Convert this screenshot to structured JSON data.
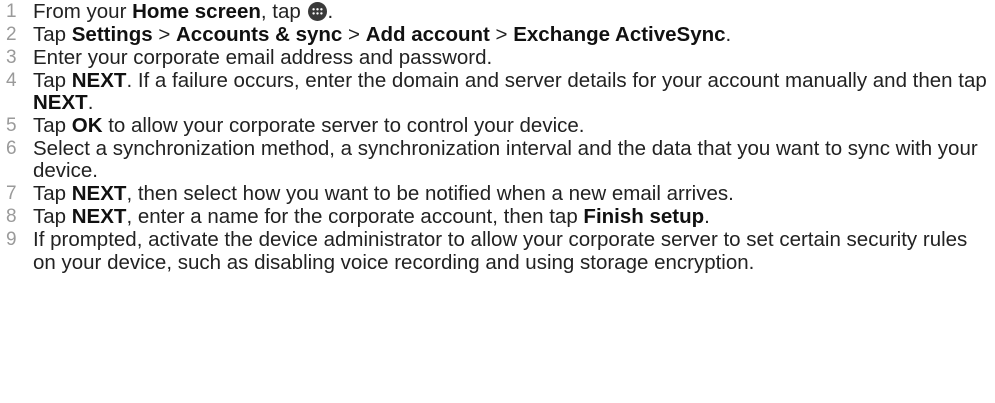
{
  "steps": [
    {
      "num": "1",
      "p1": "From your ",
      "b1": "Home screen",
      "p2": ", tap ",
      "icon": "apps-icon",
      "p3": "."
    },
    {
      "num": "2",
      "p1": "Tap ",
      "b1": "Settings",
      "p2": " > ",
      "b2": "Accounts & sync",
      "p3": " > ",
      "b3": "Add account",
      "p4": " > ",
      "b4": "Exchange ActiveSync",
      "p5": "."
    },
    {
      "num": "3",
      "p1": "Enter your corporate email address and password."
    },
    {
      "num": "4",
      "p1": "Tap ",
      "b1": "NEXT",
      "p2": ". If a failure occurs, enter the domain and server details for your account manually and then tap ",
      "b2": "NEXT",
      "p3": "."
    },
    {
      "num": "5",
      "p1": "Tap ",
      "b1": "OK",
      "p2": " to allow your corporate server to control your device."
    },
    {
      "num": "6",
      "p1": "Select a synchronization method, a synchronization interval and the data that you want to sync with your device."
    },
    {
      "num": "7",
      "p1": "Tap ",
      "b1": "NEXT",
      "p2": ", then select how you want to be notified when a new email arrives."
    },
    {
      "num": "8",
      "p1": "Tap ",
      "b1": "NEXT",
      "p2": ", enter a name for the corporate account, then tap ",
      "b2": "Finish setup",
      "p3": "."
    },
    {
      "num": "9",
      "p1": "If prompted, activate the device administrator to allow your corporate server to set certain security rules on your device, such as disabling voice recording and using storage encryption."
    }
  ]
}
